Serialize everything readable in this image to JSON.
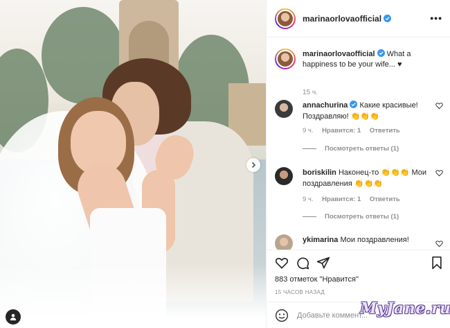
{
  "post": {
    "author": "marinaorlovaofficial",
    "verified": true
  },
  "header": {
    "username": "marinaorlovaofficial",
    "more_icon": "ellipsis-icon",
    "more_label": "•••"
  },
  "caption": {
    "username": "marinaorlovaofficial",
    "text": "What a happiness to be your wife... ♥",
    "time": "15 ч."
  },
  "comments": [
    {
      "username": "annachurina",
      "verified": true,
      "text": "Какие красивые! Поздравляю! 👏👏👏",
      "time": "9 ч.",
      "likes": "Нравится: 1",
      "reply": "Ответить",
      "view_replies": "Посмотреть ответы (1)"
    },
    {
      "username": "boriskilin",
      "verified": false,
      "text": "Наконец-то 👏👏👏 Мои поздравления 👏👏👏",
      "time": "9 ч.",
      "likes": "Нравится: 1",
      "reply": "Ответить",
      "view_replies": "Посмотреть ответы (1)"
    },
    {
      "username": "ykimarina",
      "verified": false,
      "text": "Мои поздравления!"
    }
  ],
  "actions": {
    "like_icon": "heart-icon",
    "comment_icon": "comment-icon",
    "share_icon": "send-icon",
    "save_icon": "bookmark-icon",
    "likes_text": "883 отметок \"Нравится\"",
    "posted_time": "15 ЧАСОВ НАЗАД"
  },
  "add_comment": {
    "emoji_icon": "smiley-icon",
    "placeholder": "Добавьте коммент..."
  },
  "watermark": "MyJane.ru",
  "colors": {
    "text": "#262626",
    "muted": "#8e8e8e",
    "verified": "#3897f0",
    "border": "#efefef"
  }
}
